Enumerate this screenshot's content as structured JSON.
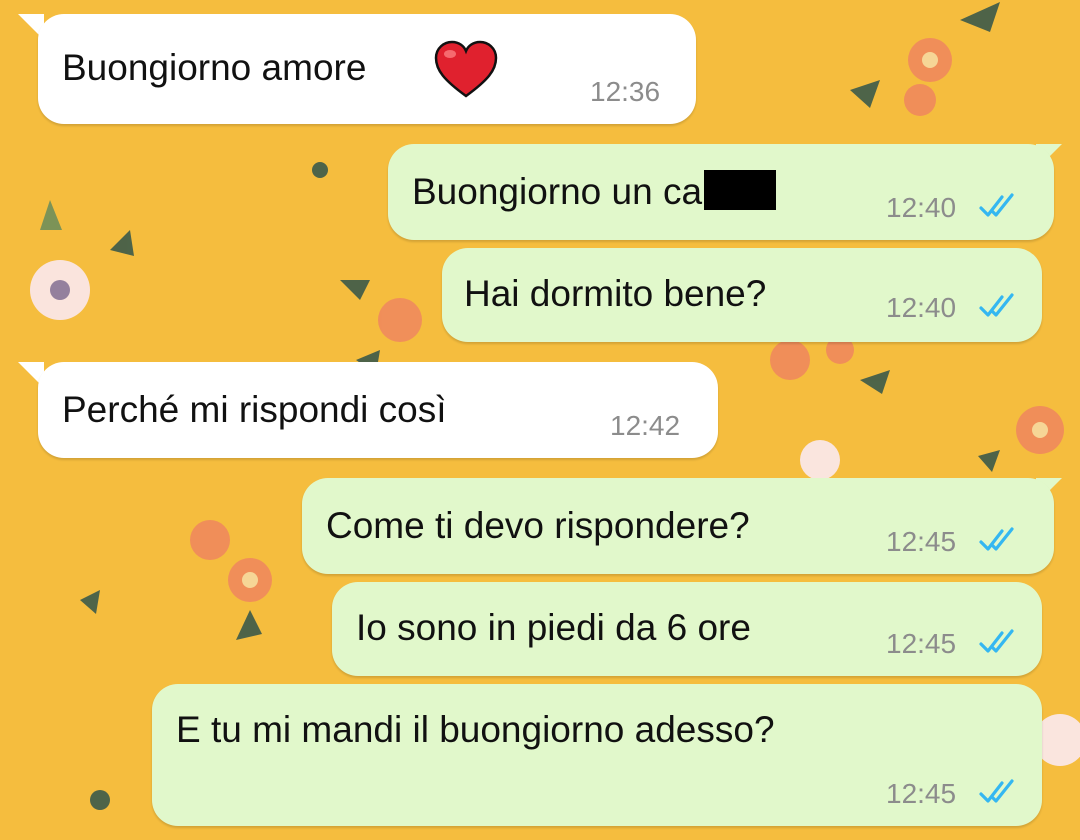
{
  "chat": {
    "messages": [
      {
        "direction": "in",
        "text": "Buongiorno amore",
        "time": "12:36",
        "emoji": "heart-icon"
      },
      {
        "direction": "out",
        "text": "Buongiorno un ca",
        "time": "12:40",
        "redacted": true,
        "status": "read"
      },
      {
        "direction": "out",
        "text": "Hai dormito bene?",
        "time": "12:40",
        "status": "read"
      },
      {
        "direction": "in",
        "text": "Perché mi rispondi così",
        "time": "12:42"
      },
      {
        "direction": "out",
        "text": "Come ti devo rispondere?",
        "time": "12:45",
        "status": "read"
      },
      {
        "direction": "out",
        "text": "Io sono in piedi da 6 ore",
        "time": "12:45",
        "status": "read"
      },
      {
        "direction": "out",
        "text": "E tu mi mandi il buongiorno adesso?",
        "time": "12:45",
        "status": "read"
      }
    ]
  },
  "colors": {
    "wallpaper": "#f5bd3e",
    "incoming_bubble": "#ffffff",
    "outgoing_bubble": "#e1f8cb",
    "read_ticks": "#34b7f1"
  }
}
